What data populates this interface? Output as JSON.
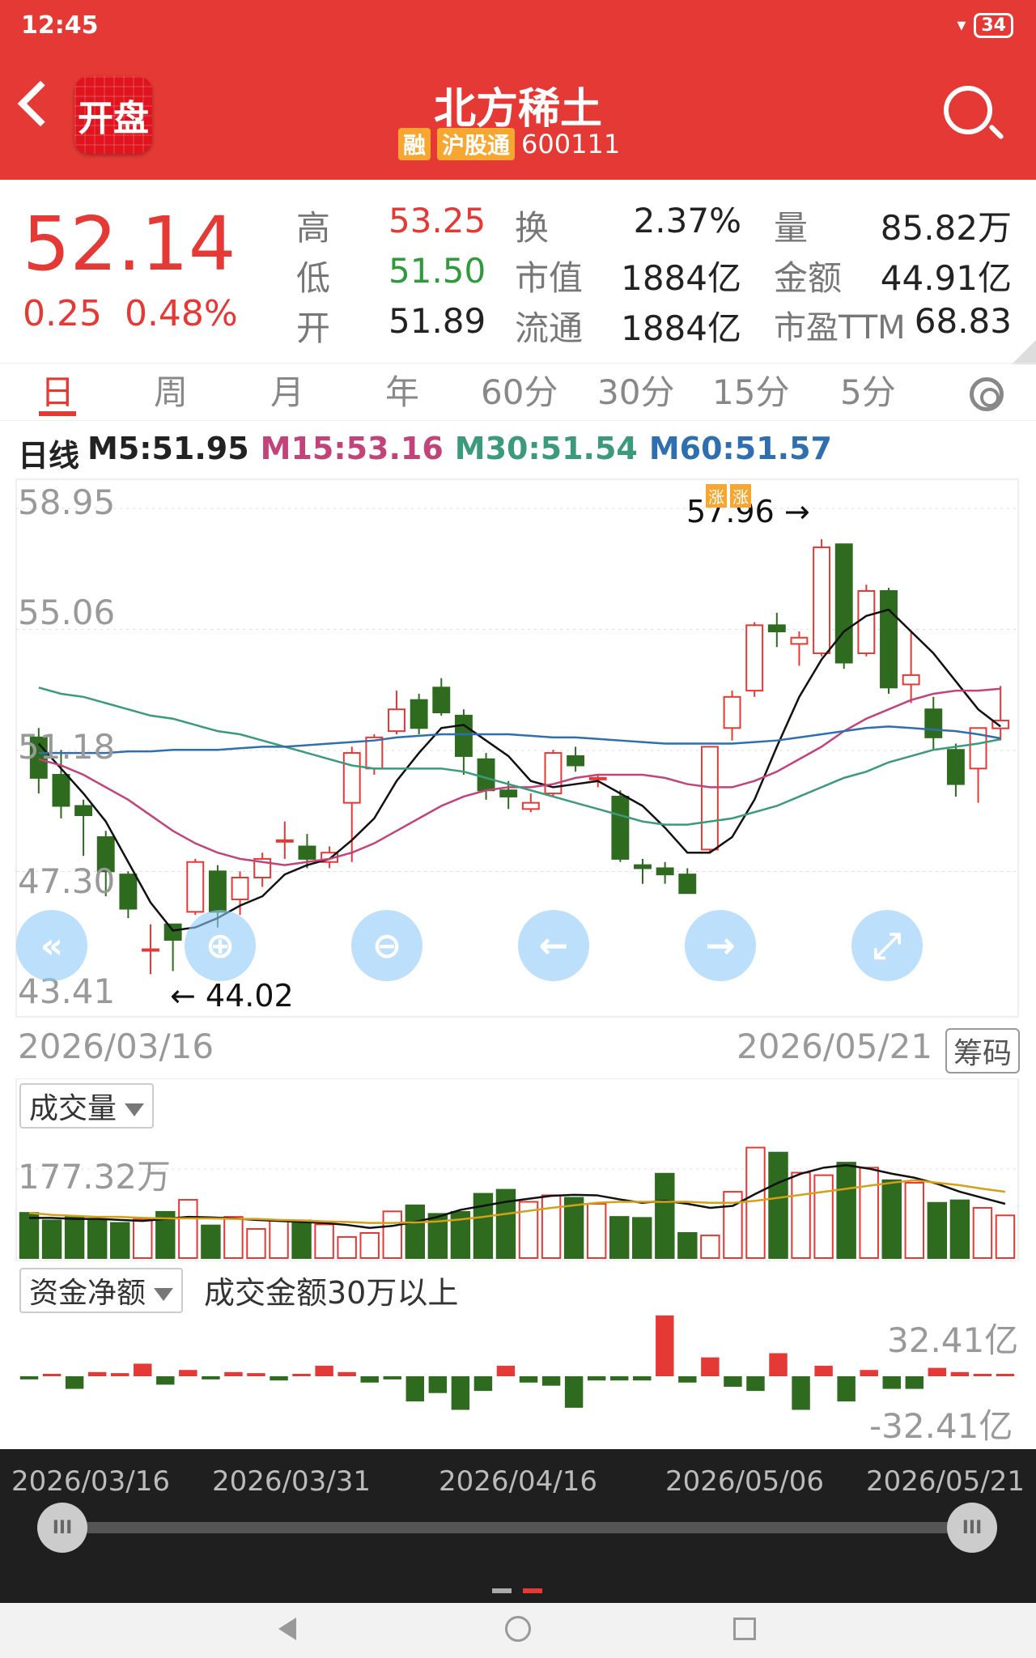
{
  "status": {
    "time": "12:45",
    "battery": "34"
  },
  "header": {
    "logo_text": "开盘",
    "title": "北方稀土",
    "badge_rong": "融",
    "badge_hgt": "沪股通",
    "code": "600111"
  },
  "quote": {
    "price": "52.14",
    "change": "0.25",
    "change_pct": "0.48%",
    "high_label": "高",
    "high": "53.25",
    "low_label": "低",
    "low": "51.50",
    "open_label": "开",
    "open": "51.89",
    "turnover_label": "换",
    "turnover": "2.37%",
    "mktcap_label": "市值",
    "mktcap": "1884亿",
    "float_label": "流通",
    "float": "1884亿",
    "vol_label": "量",
    "vol": "85.82万",
    "amount_label": "金额",
    "amount": "44.91亿",
    "pe_label": "市盈TTM",
    "pe": "68.83"
  },
  "tabs": [
    "日",
    "周",
    "月",
    "年",
    "60分",
    "30分",
    "15分",
    "5分"
  ],
  "ma": {
    "prefix": "日线",
    "m5": "M5:51.95",
    "m15": "M15:53.16",
    "m30": "M30:51.54",
    "m60": "M60:51.57"
  },
  "colors": {
    "up": "#e53935",
    "down": "#2e6b1f",
    "m5": "#111111",
    "m15": "#c2427a",
    "m30": "#3a9a7a",
    "m60": "#2f6fb0",
    "vol_ma": "#d4a017"
  },
  "chart_data": [
    {
      "type": "candlestick",
      "title": "日线",
      "x_start": "2026/03/16",
      "x_end": "2026/05/21",
      "y_tick_labels": [
        "58.95",
        "55.06",
        "51.18",
        "47.30",
        "43.41"
      ],
      "ylim": [
        43.41,
        58.95
      ],
      "annotations": [
        {
          "text": "57.96 →",
          "value": 57.96
        },
        {
          "text": "← 44.02",
          "value": 44.02
        }
      ],
      "limit_up_tags": [
        "涨",
        "涨"
      ],
      "candles": [
        {
          "o": 51.6,
          "c": 50.3,
          "h": 51.9,
          "l": 49.8
        },
        {
          "o": 50.4,
          "c": 49.4,
          "h": 51.2,
          "l": 49.0
        },
        {
          "o": 49.4,
          "c": 49.1,
          "h": 49.6,
          "l": 47.8
        },
        {
          "o": 48.4,
          "c": 47.3,
          "h": 48.6,
          "l": 46.5
        },
        {
          "o": 47.2,
          "c": 46.1,
          "h": 47.3,
          "l": 45.8
        },
        {
          "o": 44.8,
          "c": 44.8,
          "h": 45.6,
          "l": 44.0
        },
        {
          "o": 45.6,
          "c": 45.1,
          "h": 45.6,
          "l": 44.1
        },
        {
          "o": 46.0,
          "c": 47.6,
          "h": 47.7,
          "l": 45.9
        },
        {
          "o": 47.3,
          "c": 46.0,
          "h": 47.5,
          "l": 45.5
        },
        {
          "o": 46.4,
          "c": 47.1,
          "h": 47.3,
          "l": 45.9
        },
        {
          "o": 47.1,
          "c": 47.7,
          "h": 47.9,
          "l": 46.8
        },
        {
          "o": 48.3,
          "c": 48.3,
          "h": 48.9,
          "l": 47.7
        },
        {
          "o": 48.1,
          "c": 47.7,
          "h": 48.5,
          "l": 47.4
        },
        {
          "o": 47.6,
          "c": 47.9,
          "h": 48.1,
          "l": 47.4
        },
        {
          "o": 49.5,
          "c": 51.1,
          "h": 51.3,
          "l": 47.6
        },
        {
          "o": 50.6,
          "c": 51.6,
          "h": 51.7,
          "l": 50.4
        },
        {
          "o": 51.8,
          "c": 52.5,
          "h": 53.1,
          "l": 51.7
        },
        {
          "o": 52.8,
          "c": 51.9,
          "h": 53.0,
          "l": 51.7
        },
        {
          "o": 53.2,
          "c": 52.4,
          "h": 53.5,
          "l": 52.3
        },
        {
          "o": 52.3,
          "c": 51.0,
          "h": 52.5,
          "l": 50.4
        },
        {
          "o": 50.9,
          "c": 49.9,
          "h": 51.1,
          "l": 49.6
        },
        {
          "o": 49.9,
          "c": 49.7,
          "h": 50.2,
          "l": 49.3
        },
        {
          "o": 49.3,
          "c": 49.5,
          "h": 49.8,
          "l": 49.2
        },
        {
          "o": 49.8,
          "c": 51.1,
          "h": 51.2,
          "l": 49.7
        },
        {
          "o": 51.0,
          "c": 50.7,
          "h": 51.3,
          "l": 50.5
        },
        {
          "o": 50.3,
          "c": 50.3,
          "h": 50.4,
          "l": 50.0
        },
        {
          "o": 49.7,
          "c": 47.7,
          "h": 49.9,
          "l": 47.6
        },
        {
          "o": 47.5,
          "c": 47.4,
          "h": 47.7,
          "l": 46.9
        },
        {
          "o": 47.4,
          "c": 47.2,
          "h": 47.6,
          "l": 46.9
        },
        {
          "o": 47.2,
          "c": 46.6,
          "h": 47.4,
          "l": 46.6
        },
        {
          "o": 48.0,
          "c": 51.3,
          "h": 51.3,
          "l": 47.9
        },
        {
          "o": 51.9,
          "c": 52.9,
          "h": 53.1,
          "l": 51.5
        },
        {
          "o": 53.1,
          "c": 55.2,
          "h": 55.3,
          "l": 52.9
        },
        {
          "o": 55.2,
          "c": 55.0,
          "h": 55.6,
          "l": 54.5
        },
        {
          "o": 54.6,
          "c": 54.8,
          "h": 55.0,
          "l": 53.9
        },
        {
          "o": 54.3,
          "c": 57.7,
          "h": 57.96,
          "l": 54.2
        },
        {
          "o": 57.8,
          "c": 54.0,
          "h": 57.8,
          "l": 53.8
        },
        {
          "o": 54.3,
          "c": 56.3,
          "h": 56.5,
          "l": 54.2
        },
        {
          "o": 56.3,
          "c": 53.2,
          "h": 56.4,
          "l": 53.0
        },
        {
          "o": 53.3,
          "c": 53.6,
          "h": 55.0,
          "l": 52.7
        },
        {
          "o": 52.5,
          "c": 51.6,
          "h": 52.9,
          "l": 51.2
        },
        {
          "o": 51.2,
          "c": 50.1,
          "h": 51.4,
          "l": 49.7
        },
        {
          "o": 50.6,
          "c": 51.9,
          "h": 51.9,
          "l": 49.5
        },
        {
          "o": 51.89,
          "c": 52.14,
          "h": 53.25,
          "l": 51.5
        }
      ],
      "series": [
        {
          "name": "M5",
          "values": [
            51.4,
            50.6,
            49.8,
            48.9,
            47.6,
            46.3,
            45.4,
            45.5,
            45.8,
            46.2,
            46.5,
            47.2,
            47.5,
            47.7,
            48.3,
            49.0,
            50.2,
            51.1,
            51.9,
            52.0,
            51.5,
            51.0,
            50.2,
            50.0,
            50.1,
            50.2,
            49.8,
            49.4,
            48.7,
            47.9,
            47.9,
            48.4,
            49.6,
            51.3,
            52.9,
            54.1,
            55.0,
            55.5,
            55.7,
            55.0,
            54.3,
            53.4,
            52.5,
            51.95
          ]
        },
        {
          "name": "M15",
          "values": [
            50.9,
            50.7,
            50.4,
            50.0,
            49.6,
            49.1,
            48.6,
            48.2,
            47.9,
            47.7,
            47.6,
            47.5,
            47.6,
            47.7,
            47.9,
            48.2,
            48.6,
            49.0,
            49.4,
            49.7,
            49.9,
            50.0,
            50.0,
            50.1,
            50.3,
            50.4,
            50.4,
            50.4,
            50.3,
            50.1,
            50.0,
            50.0,
            50.2,
            50.5,
            50.9,
            51.3,
            51.8,
            52.2,
            52.5,
            52.8,
            53.0,
            53.1,
            53.1,
            53.16
          ]
        },
        {
          "name": "M30",
          "values": [
            53.2,
            53.0,
            52.9,
            52.7,
            52.5,
            52.3,
            52.2,
            52.0,
            51.8,
            51.7,
            51.5,
            51.3,
            51.1,
            50.9,
            50.7,
            50.6,
            50.6,
            50.6,
            50.6,
            50.5,
            50.3,
            50.1,
            49.9,
            49.7,
            49.5,
            49.3,
            49.1,
            48.9,
            48.8,
            48.8,
            48.9,
            49.0,
            49.2,
            49.4,
            49.7,
            50.0,
            50.3,
            50.5,
            50.8,
            51.0,
            51.2,
            51.3,
            51.4,
            51.54
          ]
        },
        {
          "name": "M60",
          "values": [
            51.1,
            51.1,
            51.1,
            51.1,
            51.15,
            51.15,
            51.2,
            51.2,
            51.2,
            51.25,
            51.3,
            51.3,
            51.35,
            51.4,
            51.45,
            51.5,
            51.6,
            51.65,
            51.7,
            51.7,
            51.7,
            51.7,
            51.65,
            51.6,
            51.6,
            51.55,
            51.5,
            51.45,
            51.4,
            51.4,
            51.4,
            51.4,
            51.45,
            51.5,
            51.6,
            51.7,
            51.8,
            51.9,
            51.95,
            51.9,
            51.85,
            51.8,
            51.7,
            51.57
          ]
        }
      ]
    },
    {
      "type": "bar",
      "title": "成交量",
      "y_tick_labels": [
        "177.32万"
      ],
      "ylim": [
        0,
        177.32
      ],
      "values": [
        90,
        75,
        82,
        75,
        70,
        77,
        92,
        116,
        65,
        82,
        58,
        75,
        75,
        67,
        42,
        50,
        93,
        105,
        88,
        92,
        128,
        136,
        112,
        125,
        120,
        108,
        82,
        80,
        168,
        50,
        45,
        132,
        220,
        210,
        170,
        165,
        190,
        180,
        155,
        150,
        110,
        115,
        100,
        85
      ],
      "series": [
        {
          "name": "MA5",
          "values": [
            80,
            80,
            78,
            78,
            76,
            74,
            78,
            82,
            81,
            79,
            76,
            74,
            72,
            70,
            66,
            60,
            64,
            72,
            82,
            96,
            104,
            112,
            118,
            124,
            126,
            125,
            117,
            110,
            114,
            108,
            100,
            104,
            128,
            150,
            168,
            180,
            185,
            178,
            168,
            160,
            148,
            132,
            120,
            108
          ]
        },
        {
          "name": "MA10",
          "values": [
            90,
            86,
            84,
            82,
            82,
            80,
            79,
            79,
            79,
            78,
            78,
            76,
            75,
            73,
            72,
            70,
            70,
            71,
            73,
            77,
            82,
            88,
            94,
            100,
            105,
            110,
            112,
            112,
            112,
            112,
            110,
            110,
            114,
            120,
            126,
            132,
            138,
            144,
            150,
            155,
            150,
            145,
            138,
            132
          ]
        }
      ]
    },
    {
      "type": "bar",
      "title": "资金净额",
      "subtitle": "成交金额30万以上",
      "y_tick_labels": [
        "32.41亿",
        "-32.41亿"
      ],
      "ylim": [
        -32.41,
        32.41
      ],
      "values": [
        -1.5,
        0,
        -6,
        2,
        1.5,
        6,
        -4,
        3,
        -1.5,
        2,
        1.5,
        -2,
        0,
        5,
        2,
        -3,
        -1.5,
        -12,
        -8,
        -16,
        -7,
        5,
        -3,
        -4.5,
        -15,
        -2,
        -2,
        -2,
        29,
        -3,
        9,
        -5,
        -7,
        11,
        -16,
        5,
        -12,
        3,
        -6,
        -6,
        4,
        2,
        0,
        0
      ]
    }
  ],
  "price_axis_labels": [
    "58.95",
    "55.06",
    "51.18",
    "47.30",
    "43.41"
  ],
  "annotations": {
    "high": "57.96 →",
    "low": "← 44.02",
    "tag1": "涨",
    "tag2": "涨"
  },
  "date_range": {
    "start": "2026/03/16",
    "end": "2026/05/21",
    "chips": "筹码"
  },
  "volume": {
    "selector": "成交量",
    "max": "177.32万"
  },
  "flow": {
    "selector": "资金净额",
    "desc": "成交金额30万以上",
    "max": "32.41亿",
    "min": "-32.41亿"
  },
  "controls": [
    "rewind-icon",
    "zoom-in-icon",
    "zoom-out-icon",
    "left-arrow-icon",
    "right-arrow-icon",
    "fullscreen-icon"
  ],
  "timeline": {
    "dates": [
      "2026/03/16",
      "2026/03/31",
      "2026/04/16",
      "2026/05/06",
      "2026/05/21"
    ]
  }
}
